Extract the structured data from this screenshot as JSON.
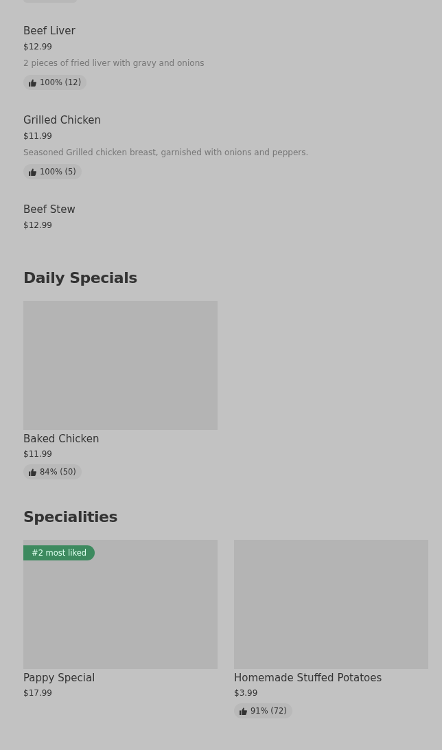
{
  "menu_items": [
    {
      "name": "Beef Liver",
      "price": "$12.99",
      "description": "2 pieces of fried liver with gravy and onions",
      "rating": "100% (12)"
    },
    {
      "name": "Grilled Chicken",
      "price": "$11.99",
      "description": "Seasoned Grilled chicken breast, garnished with onions and peppers.",
      "rating": "100% (5)"
    },
    {
      "name": "Beef Stew",
      "price": "$12.99"
    }
  ],
  "sections": [
    {
      "title": "Daily Specials",
      "cards": [
        {
          "name": "Baked Chicken",
          "price": "$11.99",
          "rating": "84% (50)"
        }
      ]
    },
    {
      "title": "Specialities",
      "cards": [
        {
          "name": "Pappy Special",
          "price": "$17.99",
          "badge": "#2 most liked"
        },
        {
          "name": "Homemade Stuffed Potatoes",
          "price": "$3.99",
          "rating": "91% (72)"
        }
      ]
    }
  ]
}
